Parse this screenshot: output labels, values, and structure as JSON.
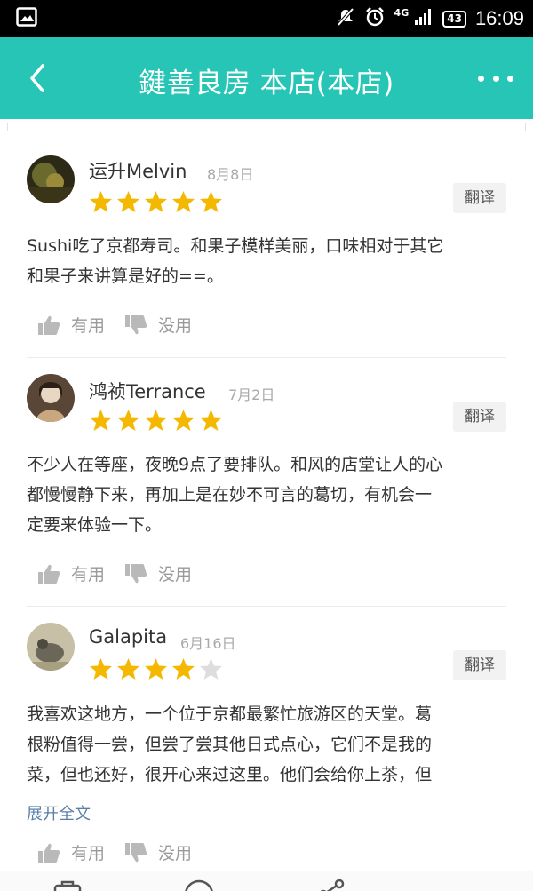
{
  "status_bar": {
    "network": "4G",
    "battery": "43",
    "time": "16:09"
  },
  "header": {
    "title": "鍵善良房 本店(本店)"
  },
  "reviews": [
    {
      "user": "运升Melvin",
      "date": "8月8日",
      "rating": 5,
      "translate_label": "翻译",
      "text_lines": [
        "Sushi吃了京都寿司。和果子模样美丽，口味相对于其它",
        "和果子来讲算是好的==。"
      ],
      "useful_label": "有用",
      "useless_label": "没用"
    },
    {
      "user": "鸿祯Terrance",
      "date": "7月2日",
      "rating": 5,
      "translate_label": "翻译",
      "text_lines": [
        "不少人在等座，夜晚9点了要排队。和风的店堂让人的心",
        "都慢慢静下来，再加上是在妙不可言的葛切，有机会一",
        "定要来体验一下。"
      ],
      "useful_label": "有用",
      "useless_label": "没用"
    },
    {
      "user": "Galapita",
      "date": "6月16日",
      "rating": 4,
      "translate_label": "翻译",
      "text_lines": [
        "我喜欢这地方，一个位于京都最繁忙旅游区的天堂。葛",
        "根粉值得一尝，但尝了尝其他日式点心，它们不是我的",
        "菜，但也还好，很开心来过这里。他们会给你上茶，但"
      ],
      "expand_label": "展开全文",
      "useful_label": "有用",
      "useless_label": "没用"
    }
  ],
  "colors": {
    "header_bg": "#27c5b5",
    "star_filled": "#f5b800",
    "star_empty": "#dddddd",
    "link": "#5a7fa8"
  }
}
